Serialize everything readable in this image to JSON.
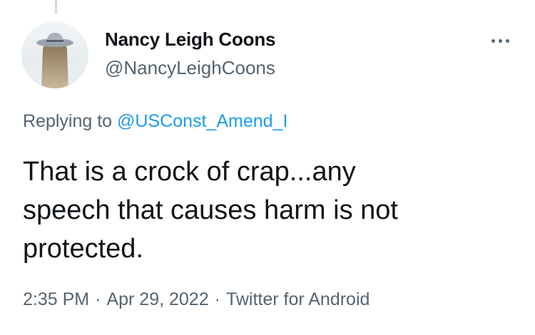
{
  "tweet": {
    "author": {
      "display_name": "Nancy Leigh Coons",
      "handle": "@NancyLeighCoons",
      "avatar_icon": "profile-photo-woman-with-hat"
    },
    "more_icon": "ellipsis-icon",
    "reply_prefix": "Replying to",
    "reply_mention": "@USConst_Amend_I",
    "text": "That is a crock of crap...any\nspeech that causes harm is not\nprotected.",
    "meta": {
      "time": "2:35 PM",
      "separator": "·",
      "date": "Apr 29, 2022",
      "source": "Twitter for Android"
    }
  },
  "colors": {
    "text_primary": "#0f1419",
    "text_secondary": "#536471",
    "link": "#1d9bf0",
    "thread_line": "#cfd9de"
  }
}
